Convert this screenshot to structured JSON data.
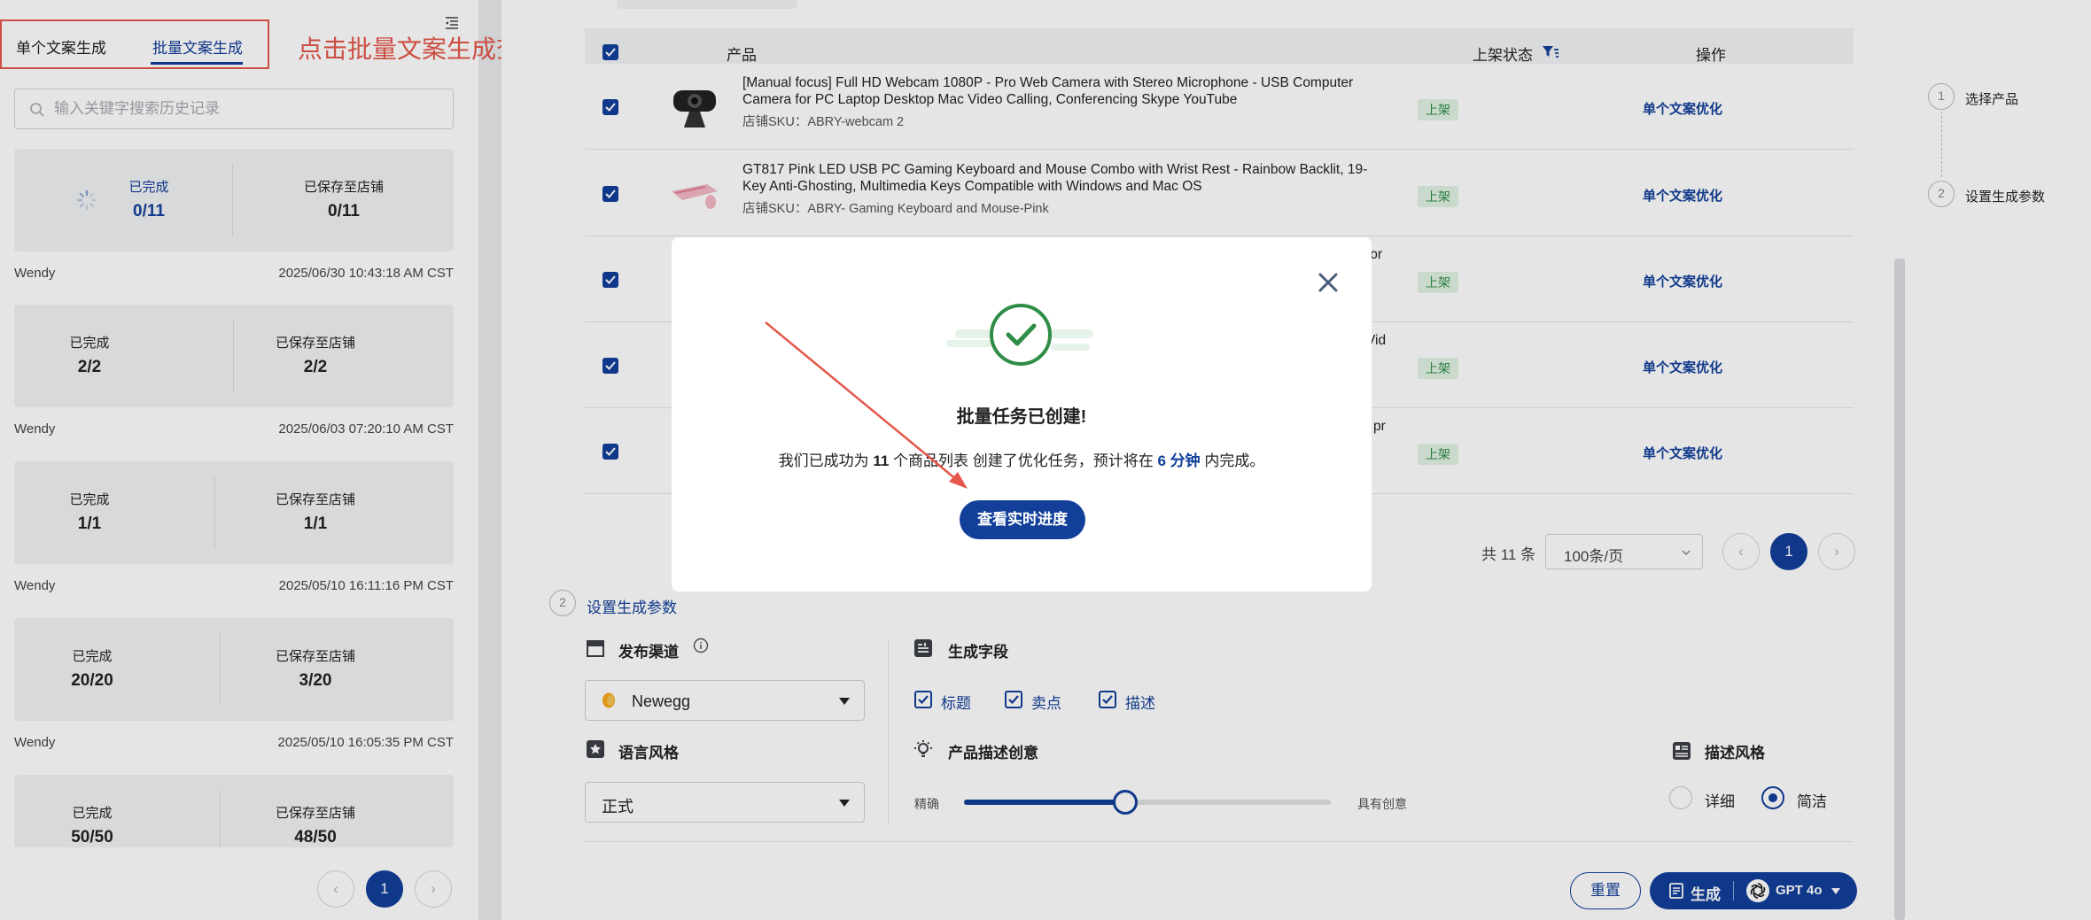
{
  "left_panel": {
    "tabs": [
      {
        "label": "单个文案生成"
      },
      {
        "label": "批量文案生成"
      }
    ],
    "annotation": "点击批量文案生成查看生成进度",
    "search_placeholder": "输入关键字搜索历史记录",
    "records": [
      {
        "left_label": "已完成",
        "left_value": "0/11",
        "right_label": "已保存至店铺",
        "right_value": "0/11",
        "user": "Wendy",
        "time": "2025/06/30 10:43:18 AM CST",
        "state": "in-progress"
      },
      {
        "left_label": "已完成",
        "left_value": "2/2",
        "right_label": "已保存至店铺",
        "right_value": "2/2",
        "user": "Wendy",
        "time": "2025/06/03 07:20:10 AM CST"
      },
      {
        "left_label": "已完成",
        "left_value": "1/1",
        "right_label": "已保存至店铺",
        "right_value": "1/1",
        "user": "Wendy",
        "time": "2025/05/10 16:11:16 PM CST"
      },
      {
        "left_label": "已完成",
        "left_value": "20/20",
        "right_label": "已保存至店铺",
        "right_value": "3/20",
        "user": "Wendy",
        "time": "2025/05/10 16:05:35 PM CST"
      },
      {
        "left_label": "已完成",
        "left_value": "50/50",
        "right_label": "已保存至店铺",
        "right_value": "48/50"
      }
    ],
    "pager": {
      "current": "1"
    }
  },
  "table": {
    "headers": {
      "product": "产品",
      "status": "上架状态",
      "action": "操作"
    },
    "rows": [
      {
        "title": "[Manual focus] Full HD Webcam 1080P - Pro Web Camera with Stereo Microphone - USB Computer Camera for PC Laptop Desktop Mac Video Calling, Conferencing Skype YouTube",
        "sku": "店铺SKU：ABRY-webcam 2",
        "status": "上架",
        "action": "单个文案优化"
      },
      {
        "title": "GT817 Pink LED USB PC Gaming Keyboard and Mouse Combo with Wrist Rest - Rainbow Backlit, 19-Key Anti-Ghosting, Multimedia Keys Compatible with Windows and Mac OS",
        "sku": "店铺SKU：ABRY- Gaming Keyboard and Mouse-Pink",
        "status": "上架",
        "action": "单个文案优化"
      },
      {
        "title_tail": "for",
        "status": "上架",
        "action": "单个文案优化"
      },
      {
        "title_tail": "Vid",
        "status": "上架",
        "action": "单个文案优化"
      },
      {
        "title_tail": "pr",
        "status": "上架",
        "action": "单个文案优化"
      }
    ],
    "total": "共 11 条",
    "page_size": "100条/页",
    "current_page": "1"
  },
  "stepper": {
    "steps": [
      {
        "num": "1",
        "label": "选择产品"
      },
      {
        "num": "2",
        "label": "设置生成参数"
      }
    ]
  },
  "params": {
    "section_num": "2",
    "section_title": "设置生成参数",
    "channel_label": "发布渠道",
    "channel_value": "Newegg",
    "fields_label": "生成字段",
    "fields": [
      "标题",
      "卖点",
      "描述"
    ],
    "lang_label": "语言风格",
    "lang_value": "正式",
    "creativity_label": "产品描述创意",
    "creativity_min": "精确",
    "creativity_max": "具有创意",
    "creativity_level": 0.44,
    "style_label": "描述风格",
    "style_options": [
      "详细",
      "简洁"
    ],
    "style_selected": "简洁",
    "reset_label": "重置",
    "generate_label": "生成",
    "model_label": "GPT 4o"
  },
  "modal": {
    "title": "批量任务已创建!",
    "text_pre": "我们已成功为",
    "count": "11",
    "text_mid": "个商品列表 创建了优化任务，预计将在",
    "eta": "6 分钟",
    "text_post": "内完成。",
    "button": "查看实时进度"
  },
  "colors": {
    "accent": "#123f9a",
    "annotation": "#e4574a",
    "success": "#2f8d47"
  }
}
